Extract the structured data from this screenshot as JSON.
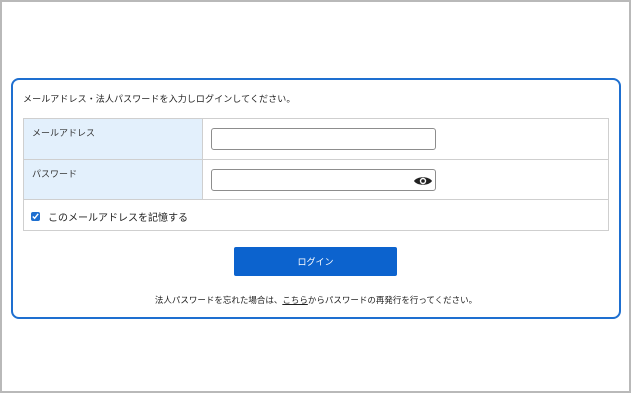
{
  "login": {
    "instruction": "メールアドレス・法人パスワードを入力しログインしてください。",
    "email_label": "メールアドレス",
    "email_value": "",
    "password_label": "パスワード",
    "password_value": "",
    "remember_label": "このメールアドレスを記憶する",
    "remember_checked": true,
    "login_button": "ログイン",
    "footer_before": "法人パスワードを忘れた場合は、",
    "footer_link": "こちら",
    "footer_after": "からパスワードの再発行を行ってください。"
  },
  "colors": {
    "accent": "#0c63ce",
    "card_border": "#1e6fd0",
    "label_bg": "#e3f0fc"
  },
  "icons": {
    "show_password": "eye-icon"
  }
}
